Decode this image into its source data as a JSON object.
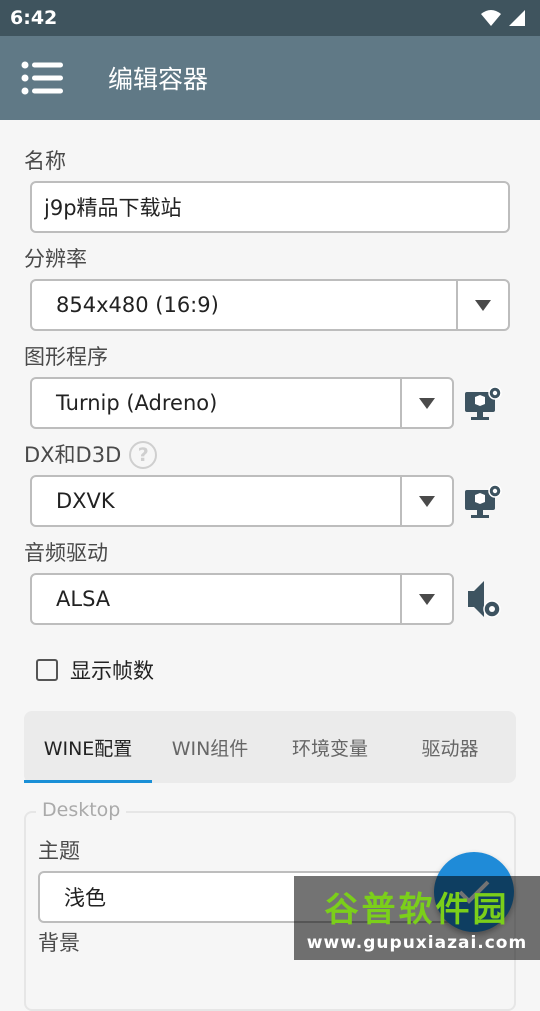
{
  "status_bar": {
    "time": "6:42"
  },
  "app_bar": {
    "title": "编辑容器"
  },
  "name_field": {
    "label": "名称",
    "value": "j9p精品下载站"
  },
  "resolution": {
    "label": "分辨率",
    "value": "854x480 (16:9)"
  },
  "graphics": {
    "label": "图形程序",
    "value": "Turnip (Adreno)"
  },
  "dx": {
    "label": "DX和D3D",
    "help": "?",
    "value": "DXVK"
  },
  "audio": {
    "label": "音频驱动",
    "value": "ALSA"
  },
  "fps_checkbox": {
    "label": "显示帧数",
    "checked": false
  },
  "tabs": [
    {
      "label": "WINE配置",
      "active": true
    },
    {
      "label": "WIN组件",
      "active": false
    },
    {
      "label": "环境变量",
      "active": false
    },
    {
      "label": "驱动器",
      "active": false
    }
  ],
  "desktop_group": {
    "legend": "Desktop",
    "theme_label": "主题",
    "theme_value": "浅色",
    "background_label": "背景"
  },
  "watermark": {
    "main": "谷普软件园",
    "sub": "www.gupuxiazai.com"
  },
  "colors": {
    "status_bar": "#3f545e",
    "app_bar": "#607986",
    "accent": "#1a8fd6",
    "fab": "#1f8bd8"
  }
}
